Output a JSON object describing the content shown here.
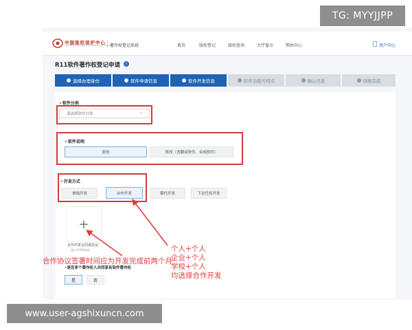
{
  "watermarks": {
    "top_right": "TG: MYYJJPP",
    "bottom_left": "www.user-agshixuncn.com"
  },
  "header": {
    "logo_text": "中国版权保护中心",
    "logo_sub": "COPYRIGHT PROTECTION CENTER OF CHINA",
    "system_name": "著作权登记系统",
    "nav": [
      "首页",
      "版权登记",
      "版权查询",
      "大厅窗点",
      "帮助中心"
    ],
    "user": "用户中心"
  },
  "page": {
    "title": "R11软件著作权登记申请",
    "info_icon": "info-icon"
  },
  "steps": [
    {
      "label": "选择办理身份",
      "state": "done"
    },
    {
      "label": "软件申请信息",
      "state": "done"
    },
    {
      "label": "软件开发信息",
      "state": "current"
    },
    {
      "label": "软件功能与特点",
      "state": "todo"
    },
    {
      "label": "确认信息",
      "state": "todo"
    },
    {
      "label": "填报完成",
      "state": "todo"
    }
  ],
  "software_category": {
    "label": "软件分类",
    "placeholder": "请选择软件分类"
  },
  "software_description": {
    "label": "软件说明",
    "options": [
      "原创",
      "修改（含翻译软件、合成软件）"
    ],
    "selected": "原创"
  },
  "development_method": {
    "label": "开发方式",
    "options": [
      "单独开发",
      "合作开发",
      "委托开发",
      "下达任务开发"
    ],
    "selected": "合作开发"
  },
  "upload": {
    "caption": "合作开发合同或协议",
    "sub": "请上传合同协议"
  },
  "annotations": {
    "left": "合作协议签署时间应为开发完成前两个月",
    "right": [
      "个人+个人",
      "企业+个人",
      "学校+个人",
      "均选择合作开发"
    ]
  },
  "multi_owner": {
    "question": "是否多个著作权人共同享有软件著作权",
    "options": [
      "是",
      "否"
    ],
    "selected": "是"
  },
  "colors": {
    "primary": "#1f63b5",
    "annotation_red": "#e03c3c"
  }
}
